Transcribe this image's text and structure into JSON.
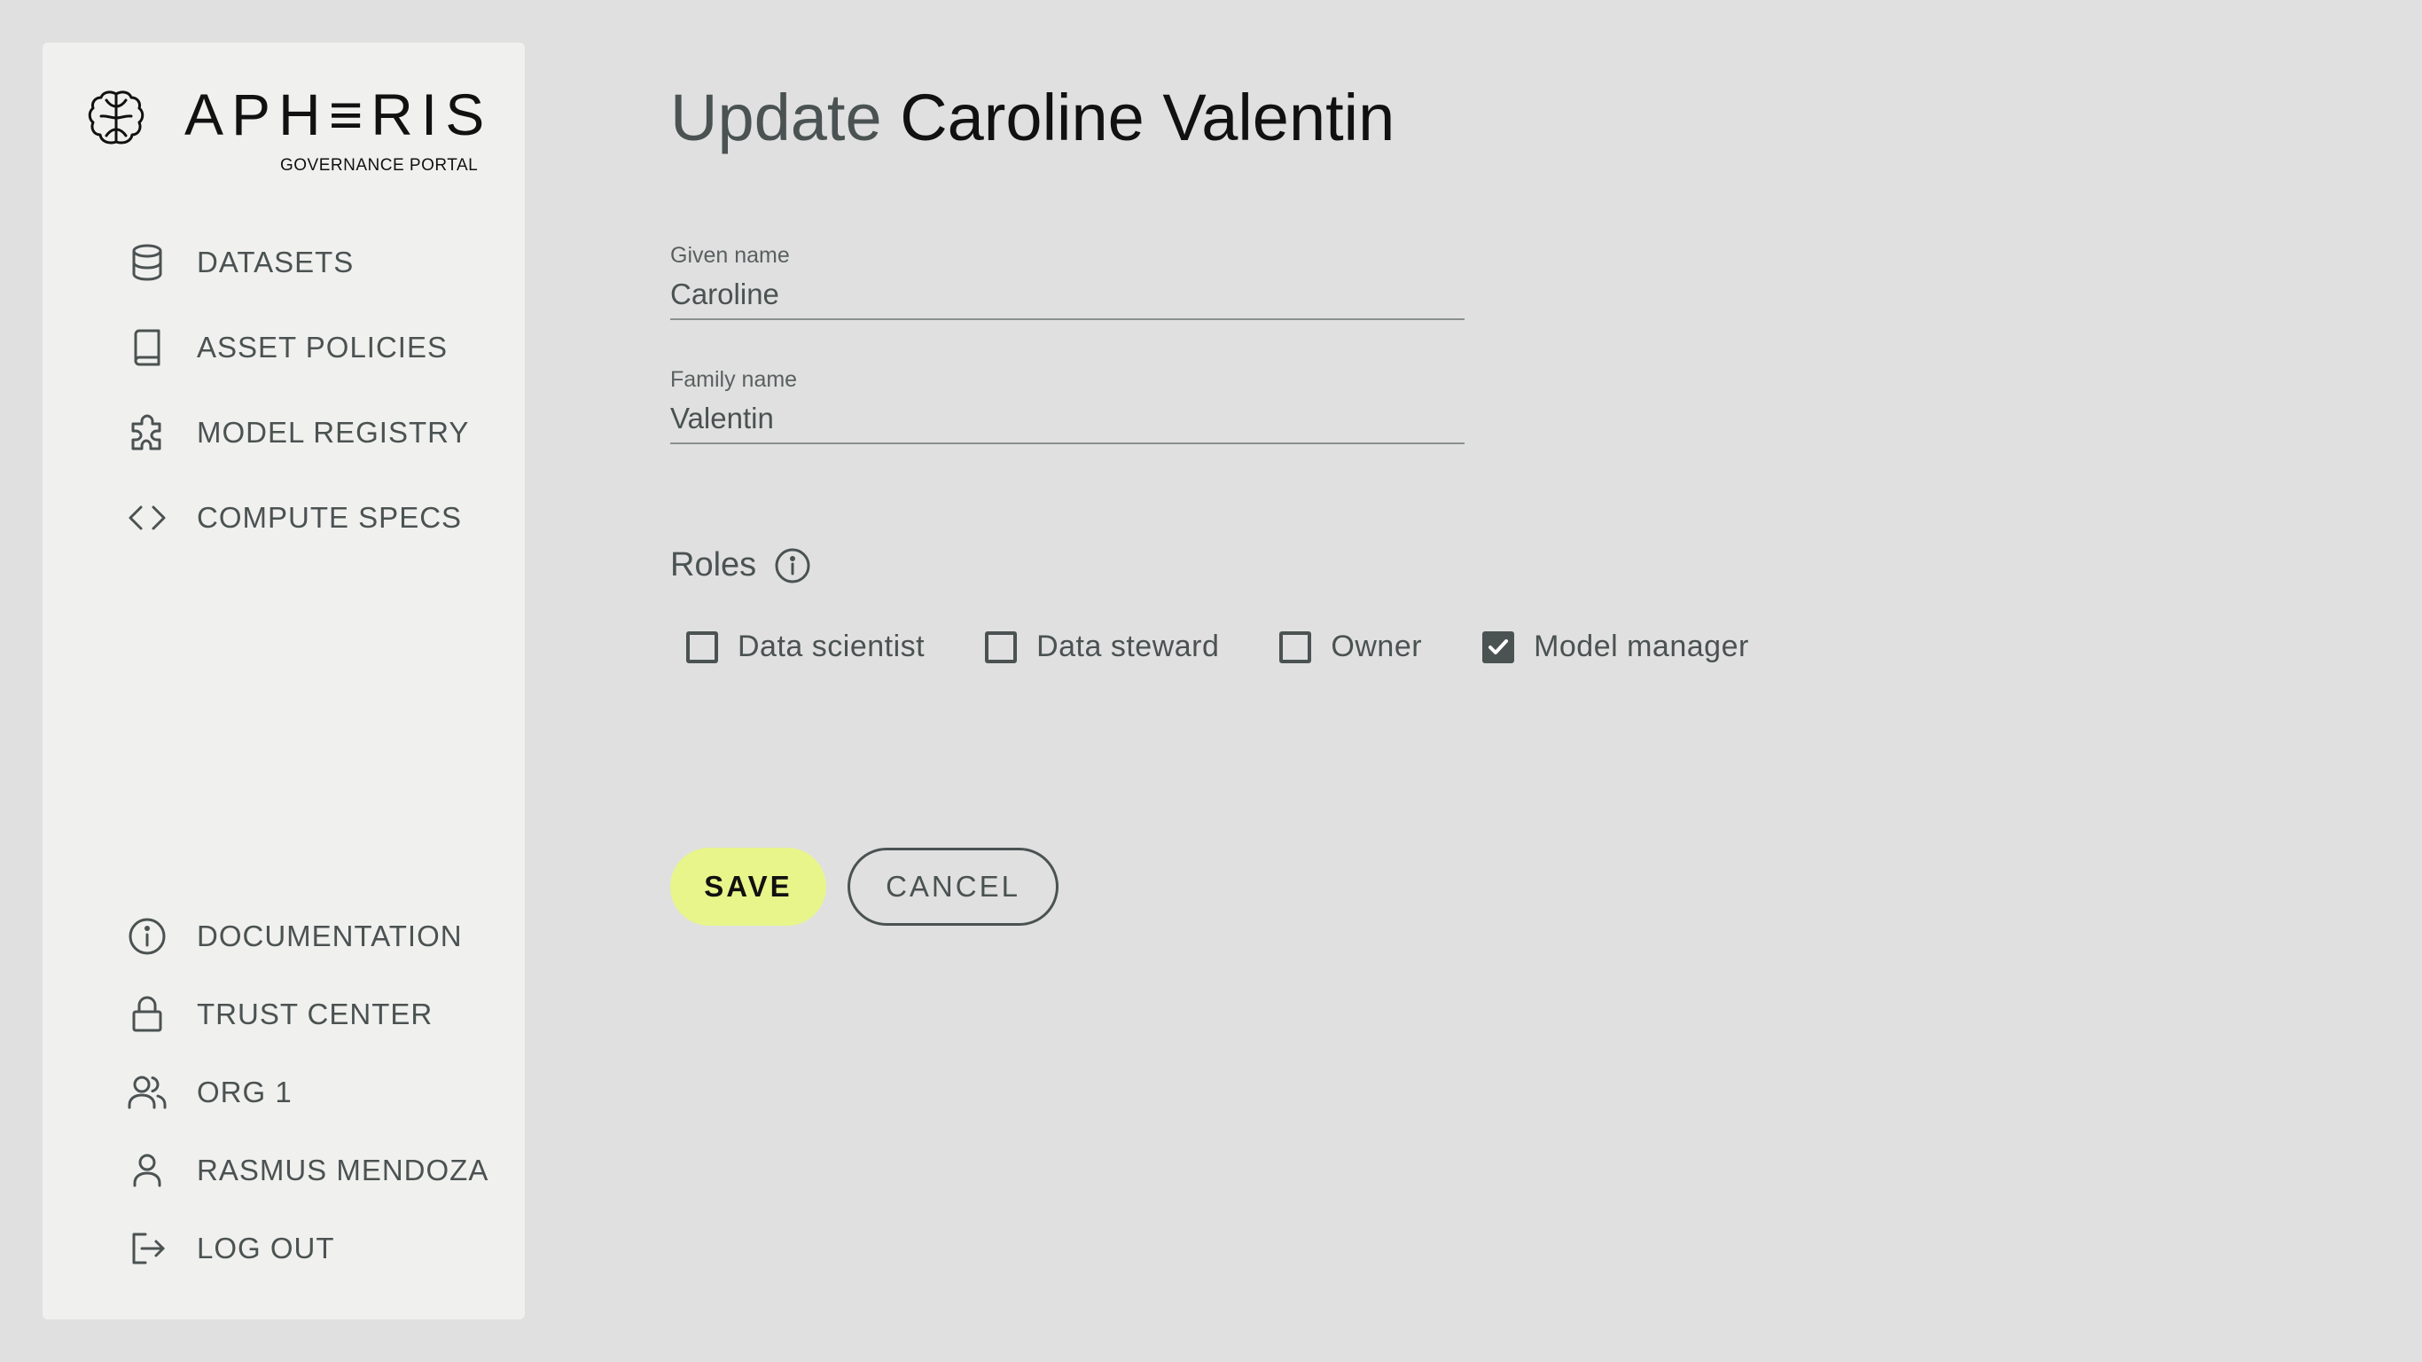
{
  "brand": {
    "name": "APH≡RIS",
    "subtitle": "GOVERNANCE PORTAL"
  },
  "sidebar": {
    "top_items": [
      {
        "label": "DATASETS",
        "icon": "database-icon"
      },
      {
        "label": "ASSET POLICIES",
        "icon": "book-icon"
      },
      {
        "label": "MODEL REGISTRY",
        "icon": "puzzle-icon"
      },
      {
        "label": "COMPUTE SPECS",
        "icon": "code-icon"
      }
    ],
    "bottom_items": [
      {
        "label": "DOCUMENTATION",
        "icon": "info-icon"
      },
      {
        "label": "TRUST CENTER",
        "icon": "lock-icon"
      },
      {
        "label": "ORG 1",
        "icon": "users-icon"
      },
      {
        "label": "RASMUS MENDOZA",
        "icon": "user-icon"
      },
      {
        "label": "LOG OUT",
        "icon": "logout-icon"
      }
    ]
  },
  "main": {
    "title_prefix": "Update",
    "title_name": "Caroline Valentin",
    "given_name": {
      "label": "Given name",
      "value": "Caroline"
    },
    "family_name": {
      "label": "Family name",
      "value": "Valentin"
    },
    "roles_title": "Roles",
    "roles": [
      {
        "label": "Data scientist",
        "checked": false
      },
      {
        "label": "Data steward",
        "checked": false
      },
      {
        "label": "Owner",
        "checked": false
      },
      {
        "label": "Model manager",
        "checked": true
      }
    ],
    "save_label": "SAVE",
    "cancel_label": "CANCEL"
  },
  "colors": {
    "background": "#e0e0e0",
    "sidebar": "#f0f0ef",
    "accent": "#e8f58a",
    "text": "#4b5252"
  }
}
